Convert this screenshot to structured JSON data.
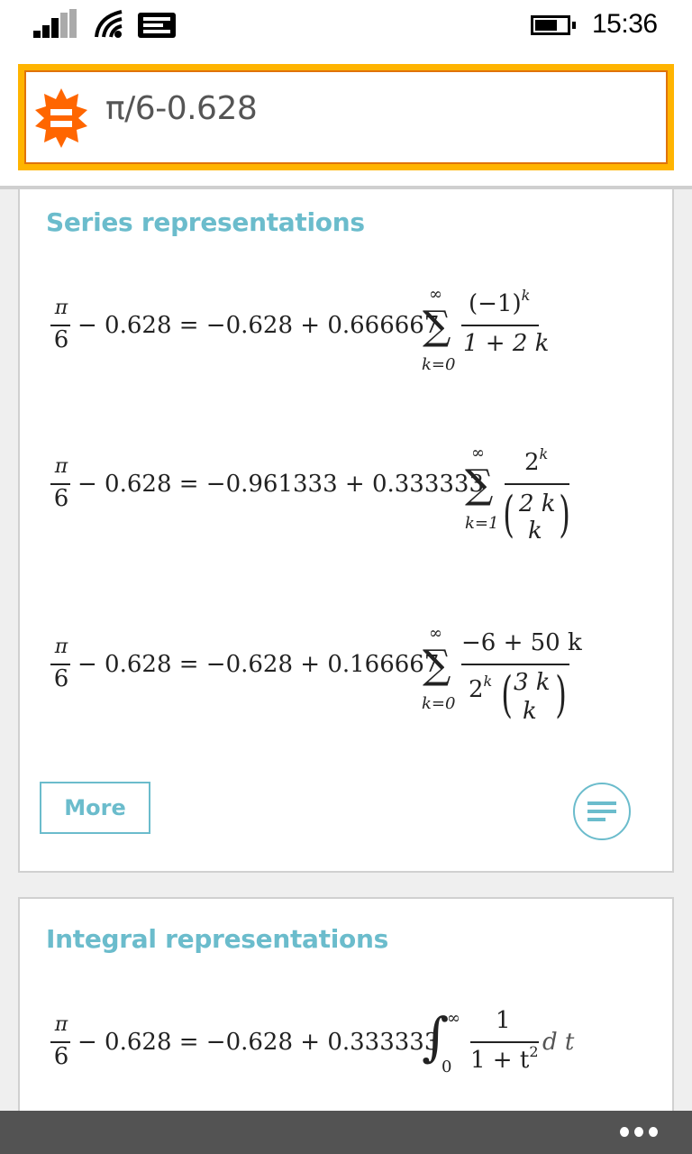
{
  "status_bar": {
    "time": "15:36",
    "icons": [
      "signal-icon",
      "wifi-icon",
      "notification-icon",
      "battery-icon"
    ]
  },
  "query": {
    "value": "π/6-0.628",
    "logo": "wolfram-alpha-logo-icon"
  },
  "colors": {
    "accent": "#6bbccc",
    "query_border_outer": "#ffb400",
    "query_border_inner": "#e0730b",
    "logo": "#ff6600",
    "app_bar": "#535353"
  },
  "series_card": {
    "title": "Series representations",
    "formulas": [
      {
        "lhs_num": "π",
        "lhs_den": "6",
        "lhs_rest": "− 0.628 = −0.628 + 0.666667",
        "sum_upper": "∞",
        "sum_lower": "k=0",
        "term_num": "(−1)",
        "term_num_sup": "k",
        "term_den": "1 + 2 k"
      },
      {
        "lhs_num": "π",
        "lhs_den": "6",
        "lhs_rest": "− 0.628 = −0.961333 + 0.333333",
        "sum_upper": "∞",
        "sum_lower": "k=1",
        "term_num": "2",
        "term_num_sup": "k",
        "term_den_binom_top": "2 k",
        "term_den_binom_bottom": "k"
      },
      {
        "lhs_num": "π",
        "lhs_den": "6",
        "lhs_rest": "− 0.628 = −0.628 + 0.166667",
        "sum_upper": "∞",
        "sum_lower": "k=0",
        "term_num": "−6 + 50 k",
        "term_den_prefix": "2",
        "term_den_prefix_sup": "k",
        "term_den_binom_top": "3 k",
        "term_den_binom_bottom": "k"
      }
    ],
    "more_label": "More",
    "step_button_icon": "steps-lines-icon"
  },
  "integral_card": {
    "title": "Integral representations",
    "formula": {
      "lhs_num": "π",
      "lhs_den": "6",
      "lhs_rest": "− 0.628 = −0.628 + 0.333333",
      "int_upper": "∞",
      "int_lower": "0",
      "term_num": "1",
      "term_den": "1 + t",
      "term_den_sup": "2",
      "differential": "d t"
    }
  },
  "app_bar": {
    "more_icon": "ellipsis-icon"
  }
}
